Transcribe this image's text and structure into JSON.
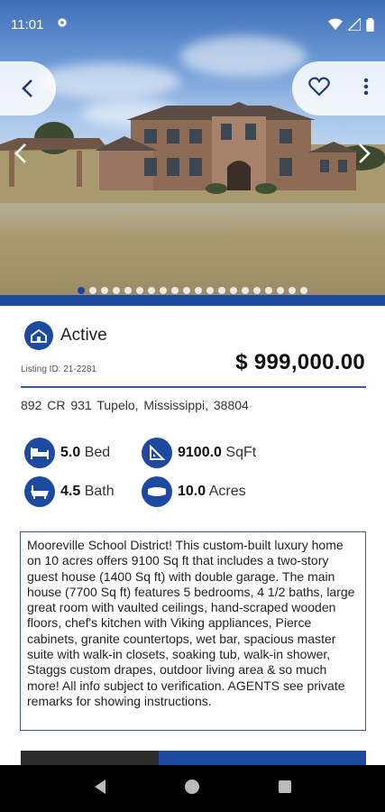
{
  "status_bar": {
    "time": "11:01",
    "icons": [
      "settings-icon",
      "wifi-icon",
      "signal-icon",
      "battery-icon"
    ]
  },
  "gallery": {
    "photo_count": 20,
    "active_index": 0,
    "icons": {
      "back": "back-arrow-icon",
      "favorite": "heart-outline-icon",
      "more": "more-vertical-icon",
      "prev": "chevron-left-icon",
      "next": "chevron-right-icon"
    }
  },
  "listing": {
    "status": "Active",
    "listing_id": "Listing ID: 21-2281",
    "price": "$ 999,000.00",
    "address": "892  CR 931  Tupelo, Mississippi, 38804"
  },
  "features": {
    "bed": {
      "value": "5.0",
      "unit": "Bed"
    },
    "bath": {
      "value": "4.5",
      "unit": "Bath"
    },
    "sqft": {
      "value": "9100.0",
      "unit": "SqFt"
    },
    "acres": {
      "value": "10.0",
      "unit": "Acres"
    }
  },
  "description": "Mooreville School District! This custom-built luxury home on 10 acres offers 9100 Sq ft that includes a two-story guest house (1400 Sq ft) with double garage. The main house (7700 Sq ft) features 5 bedrooms, 4 1/2 baths, large great room with vaulted ceilings, hand-scraped wooden floors, chef's kitchen with Viking appliances, Pierce cabinets, granite countertops, wet bar, spacious master suite with walk-in closets, soaking tub, walk-in shower, Staggs custom drapes, outdoor living area & so much more!  All info subject to verification. AGENTS see private remarks for showing instructions.",
  "colors": {
    "brand_blue": "#1b4aa0",
    "accent_line": "#3a5aa0"
  }
}
